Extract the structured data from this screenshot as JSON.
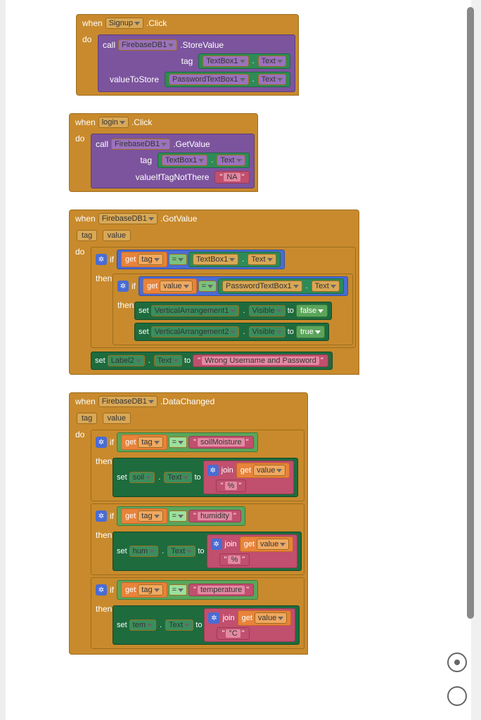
{
  "events": {
    "signup": {
      "when": "when",
      "comp": "Signup",
      "event": ".Click",
      "do": "do",
      "call": {
        "verb": "call",
        "comp": "FirebaseDB1",
        "method": ".StoreValue",
        "args": [
          {
            "name": "tag",
            "slot": {
              "type": "propget",
              "comp": "TextBox1",
              "prop": "Text"
            }
          },
          {
            "name": "valueToStore",
            "slot": {
              "type": "propget",
              "comp": "PasswordTextBox1",
              "prop": "Text"
            }
          }
        ]
      }
    },
    "login": {
      "when": "when",
      "comp": "login",
      "event": ".Click",
      "do": "do",
      "call": {
        "verb": "call",
        "comp": "FirebaseDB1",
        "method": ".GetValue",
        "args": [
          {
            "name": "tag",
            "slot": {
              "type": "propget",
              "comp": "TextBox1",
              "prop": "Text"
            }
          },
          {
            "name": "valueIfTagNotThere",
            "slot": {
              "type": "text",
              "value": "NA"
            }
          }
        ]
      }
    },
    "gotvalue": {
      "when": "when",
      "comp": "FirebaseDB1",
      "event": ".GotValue",
      "do": "do",
      "params": [
        "tag",
        "value"
      ],
      "body": {
        "if_outer": {
          "if": "if",
          "then": "then",
          "cond": {
            "op": "=",
            "left": {
              "type": "varget",
              "get": "get",
              "name": "tag"
            },
            "right": {
              "type": "propget",
              "comp": "TextBox1",
              "prop": "Text"
            }
          },
          "inner": {
            "if": "if",
            "then": "then",
            "cond": {
              "op": "=",
              "left": {
                "type": "varget",
                "get": "get",
                "name": "value"
              },
              "right": {
                "type": "propget",
                "comp": "PasswordTextBox1",
                "prop": "Text"
              }
            },
            "sets": [
              {
                "set": "set",
                "comp": "VerticalArrangement1",
                "prop": "Visible",
                "to": "to",
                "val": "false"
              },
              {
                "set": "set",
                "comp": "VerticalArrangement2",
                "prop": "Visible",
                "to": "to",
                "val": "true"
              }
            ]
          }
        },
        "setmsg": {
          "set": "set",
          "comp": "Label2",
          "prop": "Text",
          "to": "to",
          "val": "Wrong Username and Password"
        }
      }
    },
    "datachanged": {
      "when": "when",
      "comp": "FirebaseDB1",
      "event": ".DataChanged",
      "do": "do",
      "params": [
        "tag",
        "value"
      ],
      "ifs": [
        {
          "if": "if",
          "then": "then",
          "cond": {
            "op": "=",
            "left": {
              "type": "varget",
              "get": "get",
              "name": "tag"
            },
            "right": {
              "type": "text",
              "value": "soilMoisture"
            }
          },
          "set": {
            "set": "set",
            "comp": "soil",
            "prop": "Text",
            "to": "to",
            "join": "join",
            "v": "value",
            "unit": "%"
          }
        },
        {
          "if": "if",
          "then": "then",
          "cond": {
            "op": "=",
            "left": {
              "type": "varget",
              "get": "get",
              "name": "tag"
            },
            "right": {
              "type": "text",
              "value": "humidity"
            }
          },
          "set": {
            "set": "set",
            "comp": "hum",
            "prop": "Text",
            "to": "to",
            "join": "join",
            "v": "value",
            "unit": "%"
          }
        },
        {
          "if": "if",
          "then": "then",
          "cond": {
            "op": "=",
            "left": {
              "type": "varget",
              "get": "get",
              "name": "tag"
            },
            "right": {
              "type": "text",
              "value": "temperature"
            }
          },
          "set": {
            "set": "set",
            "comp": "tem",
            "prop": "Text",
            "to": "to",
            "join": "join",
            "v": "value",
            "unit": "°C"
          }
        }
      ]
    }
  },
  "get_label": "get"
}
